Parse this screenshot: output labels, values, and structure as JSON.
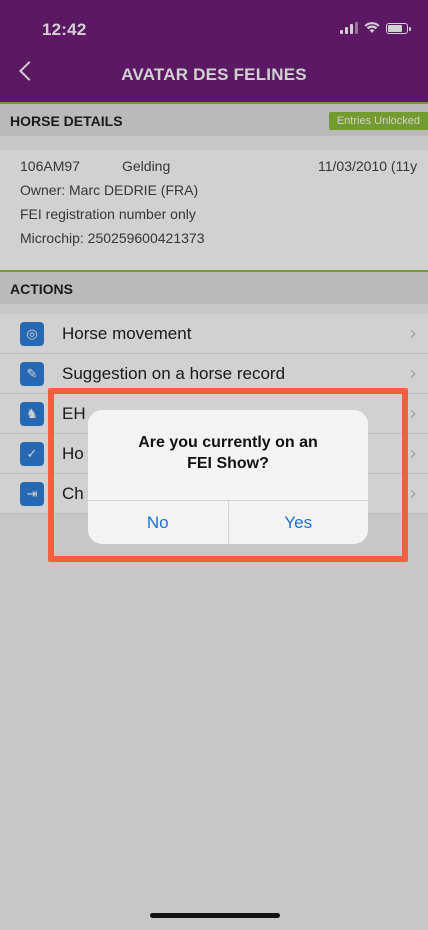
{
  "status_bar": {
    "time": "12:42"
  },
  "header": {
    "title": "AVATAR DES FELINES"
  },
  "horse_details": {
    "section_label": "HORSE DETAILS",
    "badge": "Entries Unlocked",
    "id": "106AM97",
    "sex": "Gelding",
    "birth": "11/03/2010 (11y",
    "owner": "Owner: Marc DEDRIE (FRA)",
    "registration": "FEI registration number only",
    "microchip": "Microchip: 250259600421373"
  },
  "actions": {
    "section_label": "ACTIONS",
    "items": [
      {
        "label": "Horse movement",
        "icon": "location-pin-icon"
      },
      {
        "label": "Suggestion on a horse record",
        "icon": "pencil-icon"
      },
      {
        "label": "EH",
        "icon": "horse-icon"
      },
      {
        "label": "Ho",
        "icon": "shield-icon"
      },
      {
        "label": "Ch",
        "icon": "exit-icon"
      }
    ]
  },
  "alert": {
    "message": "Are you currently on an FEI Show?",
    "no_label": "No",
    "yes_label": "Yes"
  },
  "colors": {
    "header_bg": "#6f1f7a",
    "accent_green": "#8bbf3a",
    "action_icon_bg": "#2f7fd9",
    "highlight": "#f0603d",
    "button_text": "#1f6fdc"
  }
}
